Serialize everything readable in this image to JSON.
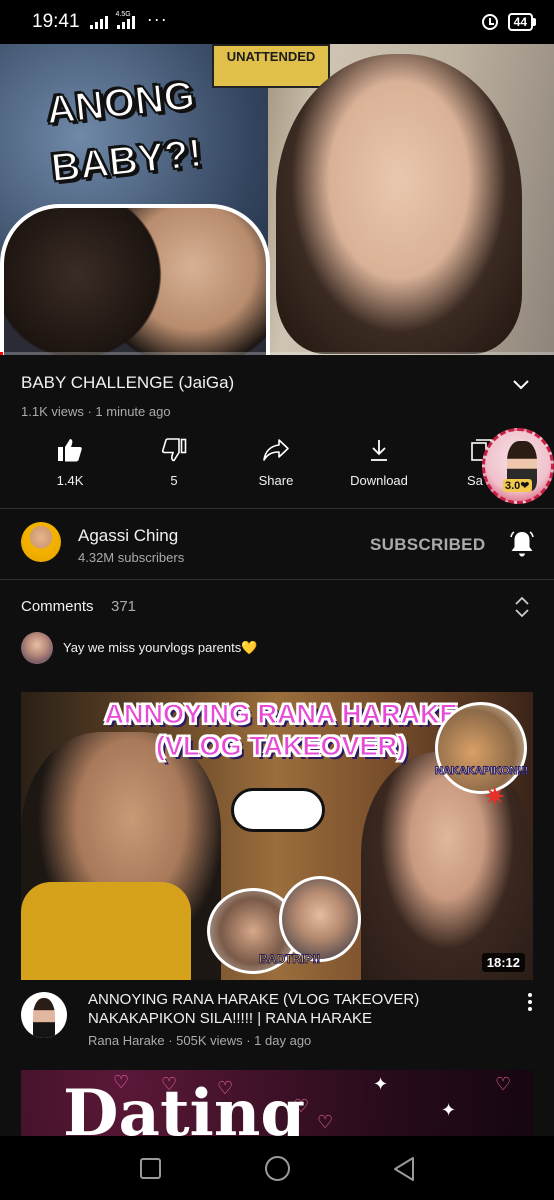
{
  "status_bar": {
    "time": "19:41",
    "network_label": "4.5G",
    "battery": "44"
  },
  "player": {
    "overlay_sign": "UNATTENDED",
    "overlay_title_line1": "ANONG",
    "overlay_title_line2": "BABY?!",
    "progress": 0.005
  },
  "video": {
    "title": "BABY CHALLENGE (JaiGa)",
    "meta": "1.1K views · 1 minute ago"
  },
  "actions": {
    "like": "1.4K",
    "dislike": "5",
    "share": "Share",
    "download": "Download",
    "save": "Sa"
  },
  "floating_badge": {
    "label": "3.0❤"
  },
  "channel": {
    "name": "Agassi Ching",
    "subscribers": "4.32M subscribers",
    "subscribe_state": "SUBSCRIBED"
  },
  "comments": {
    "label": "Comments",
    "count": "371",
    "top_comment": "Yay we miss yourvlogs parents💛"
  },
  "recommended": [
    {
      "thumb_title_line1": "ANNOYING RANA HARAKE",
      "thumb_title_line2": "(VLOG TAKEOVER)",
      "thumb_tag_1": "NAKAKAPIKON!!!",
      "thumb_tag_2": "BADTRIP!!",
      "duration": "18:12",
      "title": "ANNOYING RANA HARAKE (VLOG TAKEOVER) NAKAKAPIKON SILA!!!!! | RANA HARAKE",
      "meta": "Rana Harake · 505K views · 1 day ago"
    },
    {
      "thumb_text": "Dating"
    }
  ],
  "colors": {
    "background": "#0f0f0f",
    "text_primary": "#f1f1f1",
    "text_secondary": "#aaaaaa",
    "progress": "#ff0000"
  }
}
